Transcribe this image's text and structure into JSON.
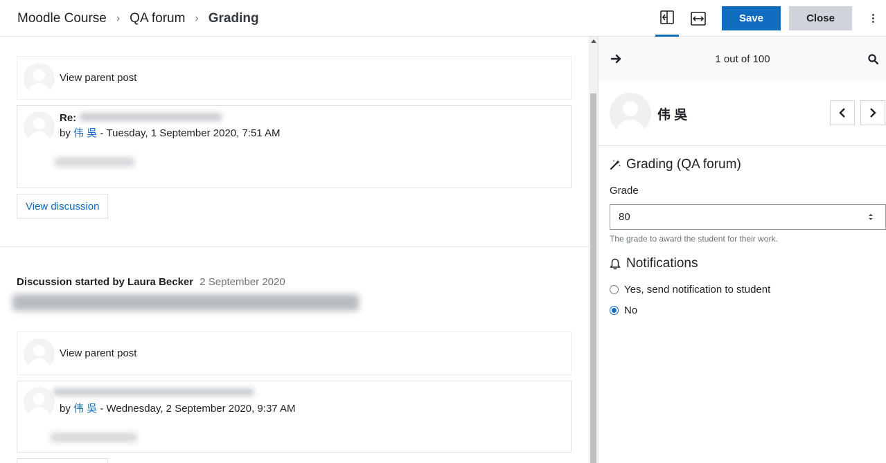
{
  "breadcrumb": {
    "items": [
      "Moodle Course",
      "QA forum"
    ],
    "current": "Grading",
    "separator": "›"
  },
  "header": {
    "icons": [
      "collapse-grader-icon",
      "view-fullwidth-icon"
    ],
    "save_label": "Save",
    "close_label": "Close"
  },
  "posts": [
    {
      "parent_link": "View parent post",
      "re_prefix": "Re:",
      "by": "by",
      "author": "伟 吳",
      "date": " - Tuesday, 1 September 2020, 7:51 AM",
      "view_discussion": "View discussion"
    },
    {
      "discussion_started_by": "Discussion started by Laura Becker",
      "discussion_date": "2 September 2020",
      "parent_link": "View parent post",
      "by": "by",
      "author": "伟 吳",
      "date": " - Wednesday, 2 September 2020, 9:37 AM"
    }
  ],
  "grader": {
    "counter": "1 out of 100",
    "user_name": "伟 吳",
    "grading_title": "Grading (QA forum)",
    "grade_label": "Grade",
    "grade_value": "80",
    "grade_help": "The grade to award the student for their work.",
    "notifications_title": "Notifications",
    "notify_options": [
      "Yes, send notification to student",
      "No"
    ],
    "notify_selected": "No"
  },
  "colors": {
    "accent": "#0f6cbf",
    "close_button": "#ced4da"
  }
}
